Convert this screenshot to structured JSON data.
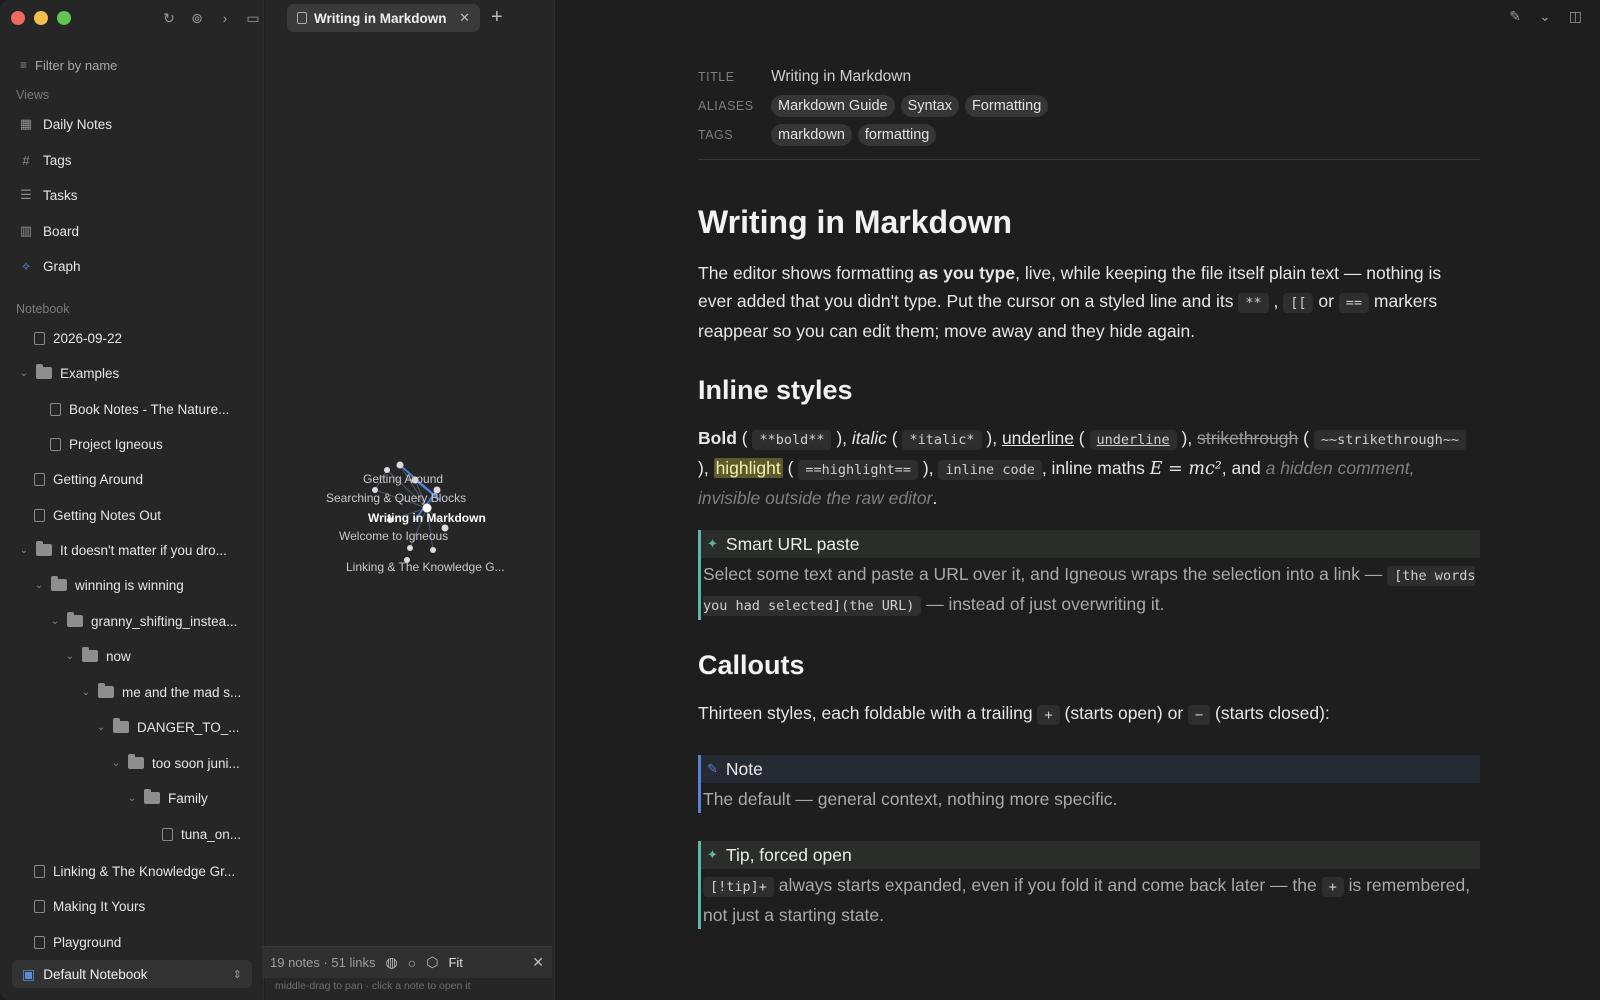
{
  "sidebar": {
    "filter_placeholder": "Filter by name",
    "views_label": "Views",
    "views": [
      {
        "label": "Daily Notes",
        "icon": "calendar-icon"
      },
      {
        "label": "Tags",
        "icon": "hash-icon"
      },
      {
        "label": "Tasks",
        "icon": "tasks-icon"
      },
      {
        "label": "Board",
        "icon": "board-icon"
      },
      {
        "label": "Graph",
        "icon": "graph-icon"
      }
    ],
    "notebook_label": "Notebook",
    "tree": [
      {
        "label": "2026-09-22"
      },
      {
        "label": "Examples"
      },
      {
        "label": "Book Notes - The Nature..."
      },
      {
        "label": "Project Igneous"
      },
      {
        "label": "Getting Around"
      },
      {
        "label": "Getting Notes Out"
      },
      {
        "label": "It doesn't matter if you dro..."
      },
      {
        "label": "winning is winning"
      },
      {
        "label": "granny_shifting_instea..."
      },
      {
        "label": "now"
      },
      {
        "label": "me and the mad s..."
      },
      {
        "label": "DANGER_TO_..."
      },
      {
        "label": "too soon juni..."
      },
      {
        "label": "Family"
      },
      {
        "label": "tuna_on..."
      },
      {
        "label": "Linking & The Knowledge Gr..."
      },
      {
        "label": "Making It Yours"
      },
      {
        "label": "Playground"
      }
    ],
    "notebook_selector": "Default Notebook"
  },
  "tab": {
    "title": "Writing in Markdown"
  },
  "graph": {
    "labels": [
      "Getting Around",
      "Searching & Query Blocks",
      "Writing in Markdown",
      "Welcome to Igneous",
      "Linking & The Knowledge G..."
    ],
    "stats": "19 notes · 51 links",
    "fit_label": "Fit",
    "hint": "middle-drag to pan · click a note to open it"
  },
  "meta": {
    "title_key": "TITLE",
    "title_value": "Writing in Markdown",
    "aliases_key": "ALIASES",
    "aliases": [
      "Markdown Guide",
      "Syntax",
      "Formatting"
    ],
    "tags_key": "TAGS",
    "tags": [
      "markdown",
      "formatting"
    ]
  },
  "doc": {
    "h1": "Writing in Markdown",
    "intro": {
      "p1": "The editor shows formatting ",
      "bold": "as you type",
      "p2": ", live, while keeping the file itself plain text — nothing is ever added that you didn't type. Put the cursor on a styled line and its ",
      "c1": "**",
      "sep1": " , ",
      "c2": "[[",
      "or": " or ",
      "c3": "==",
      "p3": " markers reappear so you can edit them; move away and they hide again."
    },
    "h2_inline": "Inline styles",
    "inline": {
      "bold_word": "Bold",
      "bold_code": "**bold**",
      "italic_word": "italic",
      "italic_code": "*italic*",
      "underline_word": "underline",
      "underline_code": "underline",
      "strike_word": "strikethrough",
      "strike_code": "~~strikethrough~~",
      "highlight_word": "highlight",
      "highlight_code": "==highlight==",
      "inline_code": "inline code",
      "maths_prefix": ", inline maths ",
      "maths": "E = mc²",
      "and": ", and",
      "hidden": "a hidden comment, invisible outside the raw editor"
    },
    "smart_paste": {
      "title": "Smart URL paste",
      "p1": "Select some text and paste a URL over it, and Igneous wraps the selection into a link — ",
      "code": "[the words you had selected](the URL)",
      "p2": " — instead of just overwriting it."
    },
    "h2_callouts": "Callouts",
    "callouts_intro": {
      "p1": "Thirteen styles, each foldable with a trailing ",
      "c1": "+",
      "p2": " (starts open) or ",
      "c2": "−",
      "p3": " (starts closed):"
    },
    "note": {
      "title": "Note",
      "body": "The default — general context, nothing more specific."
    },
    "tip": {
      "title": "Tip, forced open",
      "code1": "[!tip]+",
      "p1": " always starts expanded, even if you fold it and come back later — the ",
      "code2": "+",
      "p2": " is remembered, not just a starting state."
    }
  },
  "colors": {
    "accent": "#5a8bd8",
    "tip": "#5ab8a5",
    "note": "#5a7fd6",
    "highlight": "#5d5a2c"
  }
}
